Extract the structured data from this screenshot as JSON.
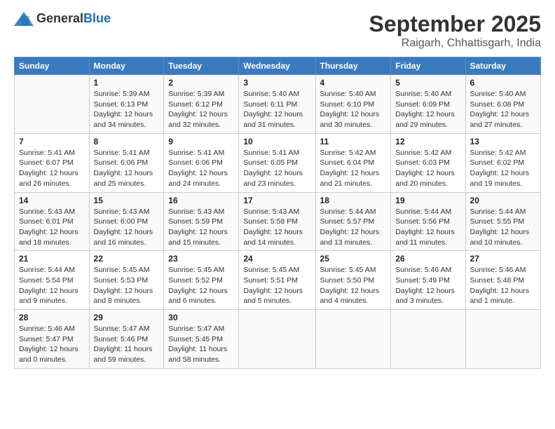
{
  "header": {
    "logo_general": "General",
    "logo_blue": "Blue",
    "title": "September 2025",
    "subtitle": "Raigarh, Chhattisgarh, India"
  },
  "calendar": {
    "days_of_week": [
      "Sunday",
      "Monday",
      "Tuesday",
      "Wednesday",
      "Thursday",
      "Friday",
      "Saturday"
    ],
    "weeks": [
      [
        {
          "date": "",
          "content": ""
        },
        {
          "date": "1",
          "sunrise": "5:39 AM",
          "sunset": "6:13 PM",
          "daylight": "12 hours and 34 minutes."
        },
        {
          "date": "2",
          "sunrise": "5:39 AM",
          "sunset": "6:12 PM",
          "daylight": "12 hours and 32 minutes."
        },
        {
          "date": "3",
          "sunrise": "5:40 AM",
          "sunset": "6:11 PM",
          "daylight": "12 hours and 31 minutes."
        },
        {
          "date": "4",
          "sunrise": "5:40 AM",
          "sunset": "6:10 PM",
          "daylight": "12 hours and 30 minutes."
        },
        {
          "date": "5",
          "sunrise": "5:40 AM",
          "sunset": "6:09 PM",
          "daylight": "12 hours and 29 minutes."
        },
        {
          "date": "6",
          "sunrise": "5:40 AM",
          "sunset": "6:08 PM",
          "daylight": "12 hours and 27 minutes."
        }
      ],
      [
        {
          "date": "7",
          "sunrise": "5:41 AM",
          "sunset": "6:07 PM",
          "daylight": "12 hours and 26 minutes."
        },
        {
          "date": "8",
          "sunrise": "5:41 AM",
          "sunset": "6:06 PM",
          "daylight": "12 hours and 25 minutes."
        },
        {
          "date": "9",
          "sunrise": "5:41 AM",
          "sunset": "6:06 PM",
          "daylight": "12 hours and 24 minutes."
        },
        {
          "date": "10",
          "sunrise": "5:41 AM",
          "sunset": "6:05 PM",
          "daylight": "12 hours and 23 minutes."
        },
        {
          "date": "11",
          "sunrise": "5:42 AM",
          "sunset": "6:04 PM",
          "daylight": "12 hours and 21 minutes."
        },
        {
          "date": "12",
          "sunrise": "5:42 AM",
          "sunset": "6:03 PM",
          "daylight": "12 hours and 20 minutes."
        },
        {
          "date": "13",
          "sunrise": "5:42 AM",
          "sunset": "6:02 PM",
          "daylight": "12 hours and 19 minutes."
        }
      ],
      [
        {
          "date": "14",
          "sunrise": "5:43 AM",
          "sunset": "6:01 PM",
          "daylight": "12 hours and 18 minutes."
        },
        {
          "date": "15",
          "sunrise": "5:43 AM",
          "sunset": "6:00 PM",
          "daylight": "12 hours and 16 minutes."
        },
        {
          "date": "16",
          "sunrise": "5:43 AM",
          "sunset": "5:59 PM",
          "daylight": "12 hours and 15 minutes."
        },
        {
          "date": "17",
          "sunrise": "5:43 AM",
          "sunset": "5:58 PM",
          "daylight": "12 hours and 14 minutes."
        },
        {
          "date": "18",
          "sunrise": "5:44 AM",
          "sunset": "5:57 PM",
          "daylight": "12 hours and 13 minutes."
        },
        {
          "date": "19",
          "sunrise": "5:44 AM",
          "sunset": "5:56 PM",
          "daylight": "12 hours and 11 minutes."
        },
        {
          "date": "20",
          "sunrise": "5:44 AM",
          "sunset": "5:55 PM",
          "daylight": "12 hours and 10 minutes."
        }
      ],
      [
        {
          "date": "21",
          "sunrise": "5:44 AM",
          "sunset": "5:54 PM",
          "daylight": "12 hours and 9 minutes."
        },
        {
          "date": "22",
          "sunrise": "5:45 AM",
          "sunset": "5:53 PM",
          "daylight": "12 hours and 8 minutes."
        },
        {
          "date": "23",
          "sunrise": "5:45 AM",
          "sunset": "5:52 PM",
          "daylight": "12 hours and 6 minutes."
        },
        {
          "date": "24",
          "sunrise": "5:45 AM",
          "sunset": "5:51 PM",
          "daylight": "12 hours and 5 minutes."
        },
        {
          "date": "25",
          "sunrise": "5:45 AM",
          "sunset": "5:50 PM",
          "daylight": "12 hours and 4 minutes."
        },
        {
          "date": "26",
          "sunrise": "5:46 AM",
          "sunset": "5:49 PM",
          "daylight": "12 hours and 3 minutes."
        },
        {
          "date": "27",
          "sunrise": "5:46 AM",
          "sunset": "5:48 PM",
          "daylight": "12 hours and 1 minute."
        }
      ],
      [
        {
          "date": "28",
          "sunrise": "5:46 AM",
          "sunset": "5:47 PM",
          "daylight": "12 hours and 0 minutes."
        },
        {
          "date": "29",
          "sunrise": "5:47 AM",
          "sunset": "5:46 PM",
          "daylight": "11 hours and 59 minutes."
        },
        {
          "date": "30",
          "sunrise": "5:47 AM",
          "sunset": "5:45 PM",
          "daylight": "11 hours and 58 minutes."
        },
        {
          "date": "",
          "content": ""
        },
        {
          "date": "",
          "content": ""
        },
        {
          "date": "",
          "content": ""
        },
        {
          "date": "",
          "content": ""
        }
      ]
    ]
  }
}
